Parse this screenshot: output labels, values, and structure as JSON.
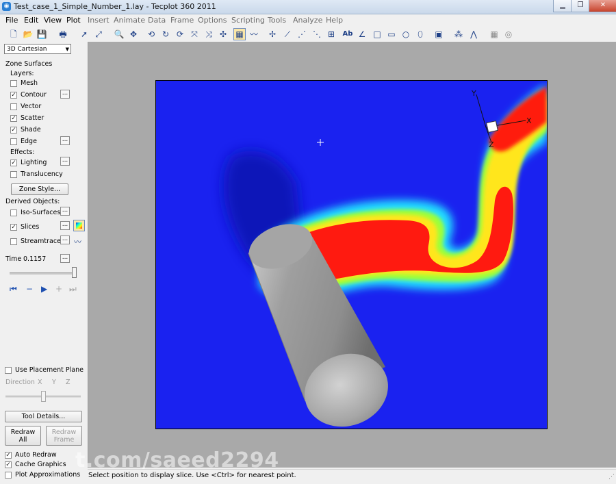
{
  "window": {
    "title": "Test_case_1_Simple_Number_1.lay - Tecplot 360 2011",
    "controls": [
      "minimize",
      "maximize",
      "close"
    ]
  },
  "menu": [
    "File",
    "Edit",
    "View",
    "Plot",
    "Insert",
    "Animate",
    "Data",
    "Frame",
    "Options",
    "Scripting",
    "Tools",
    "Analyze",
    "Help"
  ],
  "toolbar_text": {
    "text_tool": "Ab"
  },
  "sidebar": {
    "plot_type": "3D Cartesian",
    "zone_surfaces": "Zone Surfaces",
    "layers_label": "Layers:",
    "layers": [
      {
        "label": "Mesh",
        "checked": false,
        "options": false
      },
      {
        "label": "Contour",
        "checked": true,
        "options": true
      },
      {
        "label": "Vector",
        "checked": false,
        "options": false
      },
      {
        "label": "Scatter",
        "checked": true,
        "options": false
      },
      {
        "label": "Shade",
        "checked": true,
        "options": false
      },
      {
        "label": "Edge",
        "checked": false,
        "options": true
      }
    ],
    "effects_label": "Effects:",
    "effects": [
      {
        "label": "Lighting",
        "checked": true,
        "options": true
      },
      {
        "label": "Translucency",
        "checked": false,
        "options": false
      }
    ],
    "zone_style_button": "Zone Style...",
    "derived_label": "Derived Objects:",
    "derived": [
      {
        "label": "Iso-Surfaces",
        "checked": false
      },
      {
        "label": "Slices",
        "checked": true
      },
      {
        "label": "Streamtraces",
        "checked": false
      }
    ],
    "time_label": "Time",
    "time_value": "0.1157",
    "time_slider_fraction": 1.0,
    "placement_plane_label": "Use Placement Plane",
    "direction_label": "Direction",
    "direction_axes": [
      "X",
      "Y",
      "Z"
    ],
    "placement_slider_fraction": 0.5,
    "tool_details_button": "Tool Details...",
    "redraw_all": [
      "Redraw",
      "All"
    ],
    "redraw_frame": [
      "Redraw",
      "Frame"
    ],
    "bottom_options": [
      {
        "label": "Auto Redraw",
        "checked": true
      },
      {
        "label": "Cache Graphics",
        "checked": true
      },
      {
        "label": "Plot Approximations",
        "checked": false
      }
    ]
  },
  "axes_triad": {
    "x": "X",
    "y": "Y",
    "z": "Z"
  },
  "status": "Select position to display slice. Use <Ctrl> for nearest point.",
  "watermark": "t.com/saeed2294",
  "colors": {
    "background_field": "#1a22f0",
    "plume_core": "#ff1a10",
    "cylinder": "#9e9e9e",
    "workspace": "#a9a9a9"
  }
}
